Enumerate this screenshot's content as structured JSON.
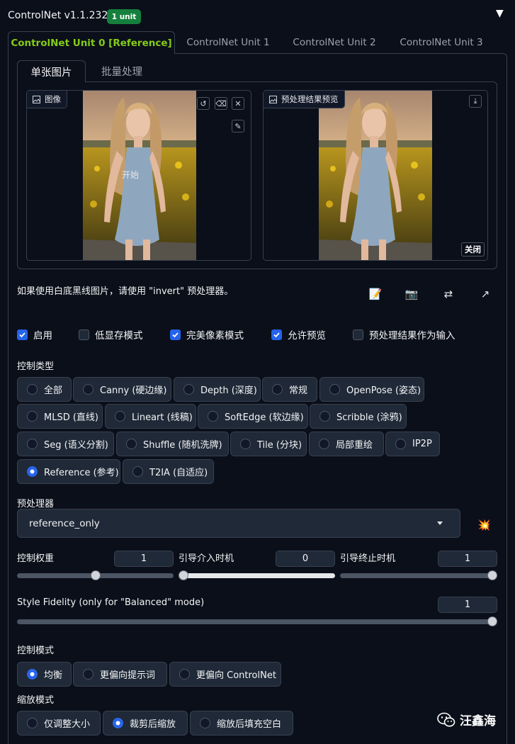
{
  "header": {
    "title": "ControlNet v1.1.232",
    "badge": "1 unit",
    "toggle": "▼"
  },
  "unit_tabs": [
    "ControlNet Unit 0 [Reference]",
    "ControlNet Unit 1",
    "ControlNet Unit 2",
    "ControlNet Unit 3"
  ],
  "image_tabs": [
    "单张图片",
    "批量处理"
  ],
  "image_panel": {
    "input_label": "图像",
    "preview_label": "预处理结果预览",
    "overlay_text": "开始",
    "close_label": "关闭"
  },
  "hint": "如果使用白底黑线图片，请使用 \"invert\" 预处理器。",
  "tools": [
    "📝",
    "📷",
    "⇄",
    "↗"
  ],
  "checkboxes": [
    {
      "label": "启用",
      "checked": true
    },
    {
      "label": "低显存模式",
      "checked": false
    },
    {
      "label": "完美像素模式",
      "checked": true
    },
    {
      "label": "允许预览",
      "checked": true
    },
    {
      "label": "预处理结果作为输入",
      "checked": false
    }
  ],
  "control_type": {
    "label": "控制类型",
    "options": [
      "全部",
      "Canny (硬边缘)",
      "Depth (深度)",
      "常规",
      "OpenPose (姿态)",
      "MLSD (直线)",
      "Lineart (线稿)",
      "SoftEdge (软边缘)",
      "Scribble (涂鸦)",
      "Seg (语义分割)",
      "Shuffle (随机洗牌)",
      "Tile (分块)",
      "局部重绘",
      "IP2P",
      "Reference (参考)",
      "T2IA (自适应)"
    ],
    "selected": "Reference (参考)"
  },
  "preprocessor": {
    "label": "预处理器",
    "value": "reference_only",
    "run_icon": "💥"
  },
  "sliders": {
    "weight": {
      "label": "控制权重",
      "value": "1"
    },
    "start": {
      "label": "引导介入时机",
      "value": "0"
    },
    "end": {
      "label": "引导终止时机",
      "value": "1"
    },
    "fidelity": {
      "label": "Style Fidelity (only for \"Balanced\" mode)",
      "value": "1"
    }
  },
  "control_mode": {
    "label": "控制模式",
    "options": [
      "均衡",
      "更偏向提示词",
      "更偏向 ControlNet"
    ],
    "selected": "均衡"
  },
  "resize_mode": {
    "label": "缩放模式",
    "options": [
      "仅调整大小",
      "裁剪后缩放",
      "缩放后填充空白"
    ],
    "selected": "裁剪后缩放"
  },
  "watermark": "汪鑫海",
  "colors": {
    "accent_green": "#84cc16",
    "badge_green": "#15803d",
    "primary_blue": "#2563eb",
    "background": "#0b0f19"
  }
}
